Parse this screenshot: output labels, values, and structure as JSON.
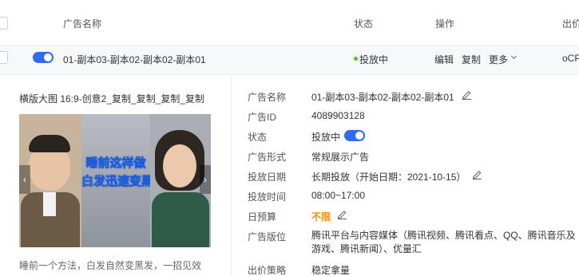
{
  "header": {
    "col_name": "广告名称",
    "col_status": "状态",
    "col_ops": "操作",
    "col_bid": "出价"
  },
  "row": {
    "ad_name": "01-副本03-副本02-副本02-副本01",
    "status": "投放中",
    "op_edit": "编辑",
    "op_copy": "复制",
    "op_more": "更多",
    "bid_type": "oCPM",
    "status_color": "#52c41a",
    "toggle_on": true,
    "accent": "#2f6bf1"
  },
  "creative": {
    "title": "横版大图 16:9-创意2_复制_复制_复制_复制",
    "image_text_line1": "睡前这样做",
    "image_text_line2": "白发迅速变黑",
    "description": "睡前一个方法，白发自然变黑发，一招见效",
    "prev_arrow": "‹",
    "next_arrow": "›"
  },
  "details": {
    "name_label": "广告名称",
    "name_value": "01-副本03-副本02-副本02-副本01",
    "id_label": "广告ID",
    "id_value": "4089903128",
    "status_label": "状态",
    "status_value": "投放中",
    "format_label": "广告形式",
    "format_value": "常规展示广告",
    "date_label": "投放日期",
    "date_value": "长期投放（开始日期：2021-10-15）",
    "time_label": "投放时间",
    "time_value": "08:00~17:00",
    "budget_label": "日预算",
    "budget_value": "不限",
    "placement_label": "广告版位",
    "placement_value": "腾讯平台与内容媒体（腾讯视频、腾讯看点、QQ、腾讯音乐及游戏、腾讯新闻）、优量汇",
    "strategy_label": "出价策略",
    "strategy_value": "稳定拿量"
  }
}
